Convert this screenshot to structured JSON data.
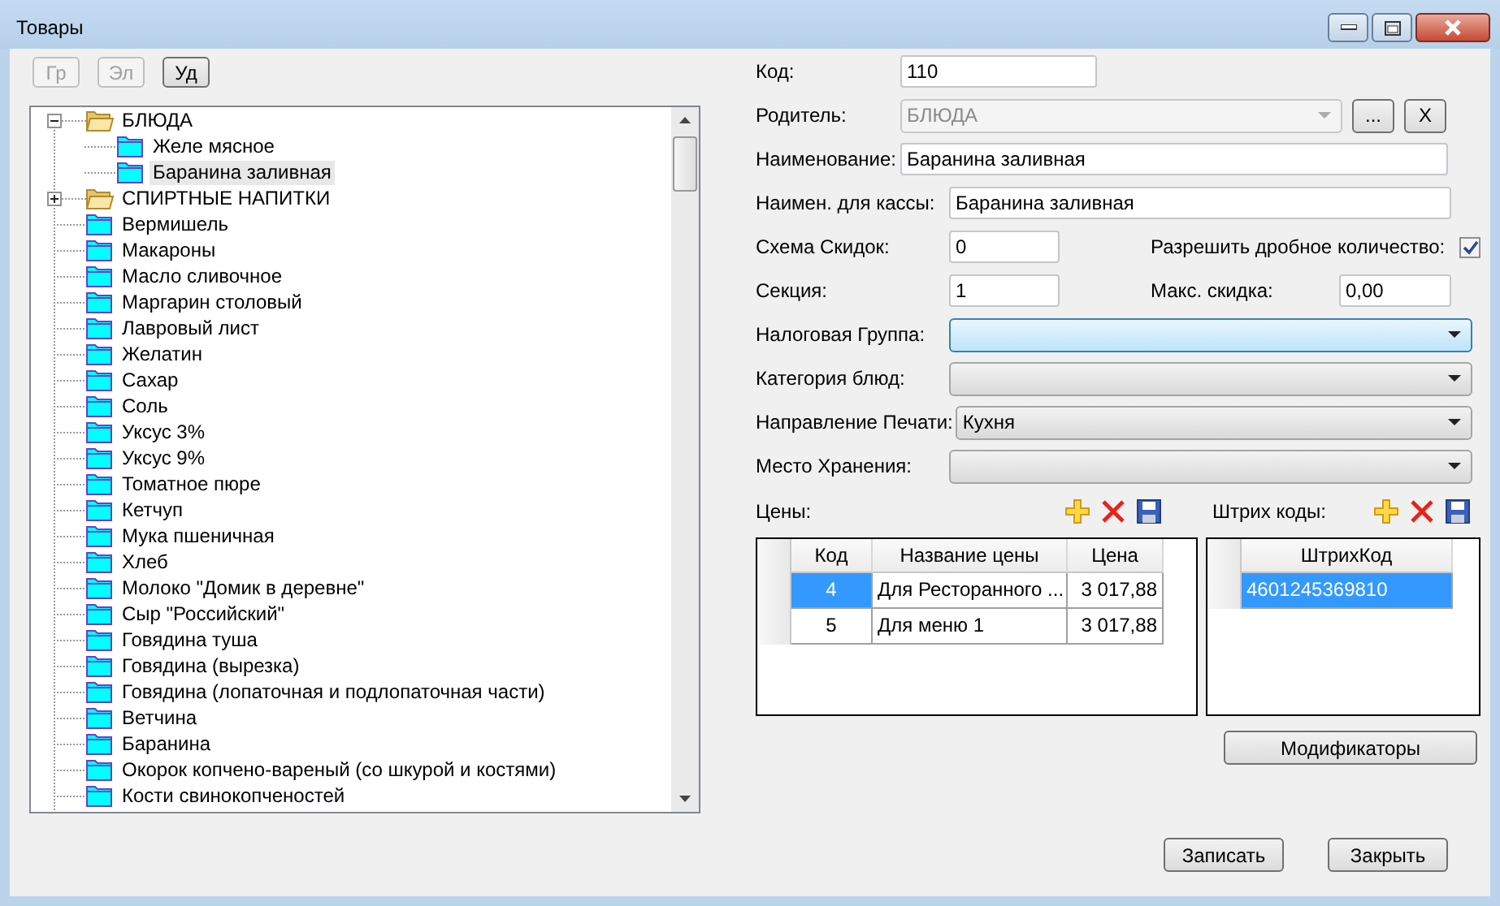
{
  "window": {
    "title": "Товары"
  },
  "toolbar": [
    {
      "label": "Гр",
      "disabled": true
    },
    {
      "label": "Эл",
      "disabled": true
    },
    {
      "label": "Уд",
      "disabled": false
    }
  ],
  "tree": [
    {
      "label": "БЛЮДА",
      "kind": "group",
      "expanded": true,
      "selected": false,
      "children": [
        {
          "label": "Желе мясное",
          "kind": "item",
          "selected": false
        },
        {
          "label": "Баранина заливная",
          "kind": "item",
          "selected": true
        }
      ]
    },
    {
      "label": "СПИРТНЫЕ НАПИТКИ",
      "kind": "group",
      "expanded": false,
      "selected": false
    },
    {
      "label": "Вермишель",
      "kind": "item",
      "selected": false
    },
    {
      "label": "Макароны",
      "kind": "item",
      "selected": false
    },
    {
      "label": "Масло сливочное",
      "kind": "item",
      "selected": false
    },
    {
      "label": "Маргарин столовый",
      "kind": "item",
      "selected": false
    },
    {
      "label": "Лавровый лист",
      "kind": "item",
      "selected": false
    },
    {
      "label": "Желатин",
      "kind": "item",
      "selected": false
    },
    {
      "label": "Сахар",
      "kind": "item",
      "selected": false
    },
    {
      "label": "Соль",
      "kind": "item",
      "selected": false
    },
    {
      "label": "Уксус 3%",
      "kind": "item",
      "selected": false
    },
    {
      "label": "Уксус 9%",
      "kind": "item",
      "selected": false
    },
    {
      "label": "Томатное пюре",
      "kind": "item",
      "selected": false
    },
    {
      "label": "Кетчуп",
      "kind": "item",
      "selected": false
    },
    {
      "label": "Мука пшеничная",
      "kind": "item",
      "selected": false
    },
    {
      "label": "Хлеб",
      "kind": "item",
      "selected": false
    },
    {
      "label": "Молоко \"Домик в деревне\"",
      "kind": "item",
      "selected": false
    },
    {
      "label": "Сыр \"Российский\"",
      "kind": "item",
      "selected": false
    },
    {
      "label": "Говядина туша",
      "kind": "item",
      "selected": false
    },
    {
      "label": "Говядина (вырезка)",
      "kind": "item",
      "selected": false
    },
    {
      "label": "Говядина (лопаточная и подлопаточная части)",
      "kind": "item",
      "selected": false
    },
    {
      "label": "Ветчина",
      "kind": "item",
      "selected": false
    },
    {
      "label": "Баранина",
      "kind": "item",
      "selected": false
    },
    {
      "label": "Окорок копчено-вареный (со шкурой и костями)",
      "kind": "item",
      "selected": false
    },
    {
      "label": "Кости свинокопченостей",
      "kind": "item",
      "selected": false
    }
  ],
  "form": {
    "code": {
      "label": "Код:",
      "value": "110"
    },
    "parent": {
      "label": "Родитель:",
      "value": "БЛЮДА",
      "disabled": true,
      "buttons": [
        "...",
        "X"
      ]
    },
    "name": {
      "label": "Наименование:",
      "value": "Баранина заливная"
    },
    "cash_name": {
      "label": "Наимен. для кассы:",
      "value": "Баранина заливная"
    },
    "discount_scheme": {
      "label": "Схема Скидок:",
      "value": "0"
    },
    "fractional": {
      "label": "Разрешить дробное количество:",
      "checked": true
    },
    "section": {
      "label": "Секция:",
      "value": "1"
    },
    "max_discount": {
      "label": "Макс. скидка:",
      "value": "0,00"
    },
    "combos": [
      {
        "label": "Налоговая Группа:",
        "focused": true
      },
      {
        "label": "Категория блюд:",
        "focused": false
      },
      {
        "label": "Направление Печати:",
        "value": "Кухня",
        "focused": false
      },
      {
        "label": "Место Хранения:",
        "focused": false
      }
    ]
  },
  "prices": {
    "label": "Цены:",
    "columns": [
      "Код",
      "Название цены",
      "Цена"
    ],
    "rows": [
      {
        "cells": [
          "4",
          "Для Ресторанного ...",
          "3 017,88"
        ],
        "selected": true
      },
      {
        "cells": [
          "5",
          "Для меню 1",
          "3 017,88"
        ],
        "selected": false
      }
    ]
  },
  "barcodes": {
    "label": "Штрих коды:",
    "columns": [
      "ШтрихКод"
    ],
    "rows": [
      {
        "cells": [
          "4601245369810"
        ],
        "selected": true
      }
    ]
  },
  "modifiers_button": "Модификаторы",
  "footer_buttons": [
    "Записать",
    "Закрыть"
  ]
}
